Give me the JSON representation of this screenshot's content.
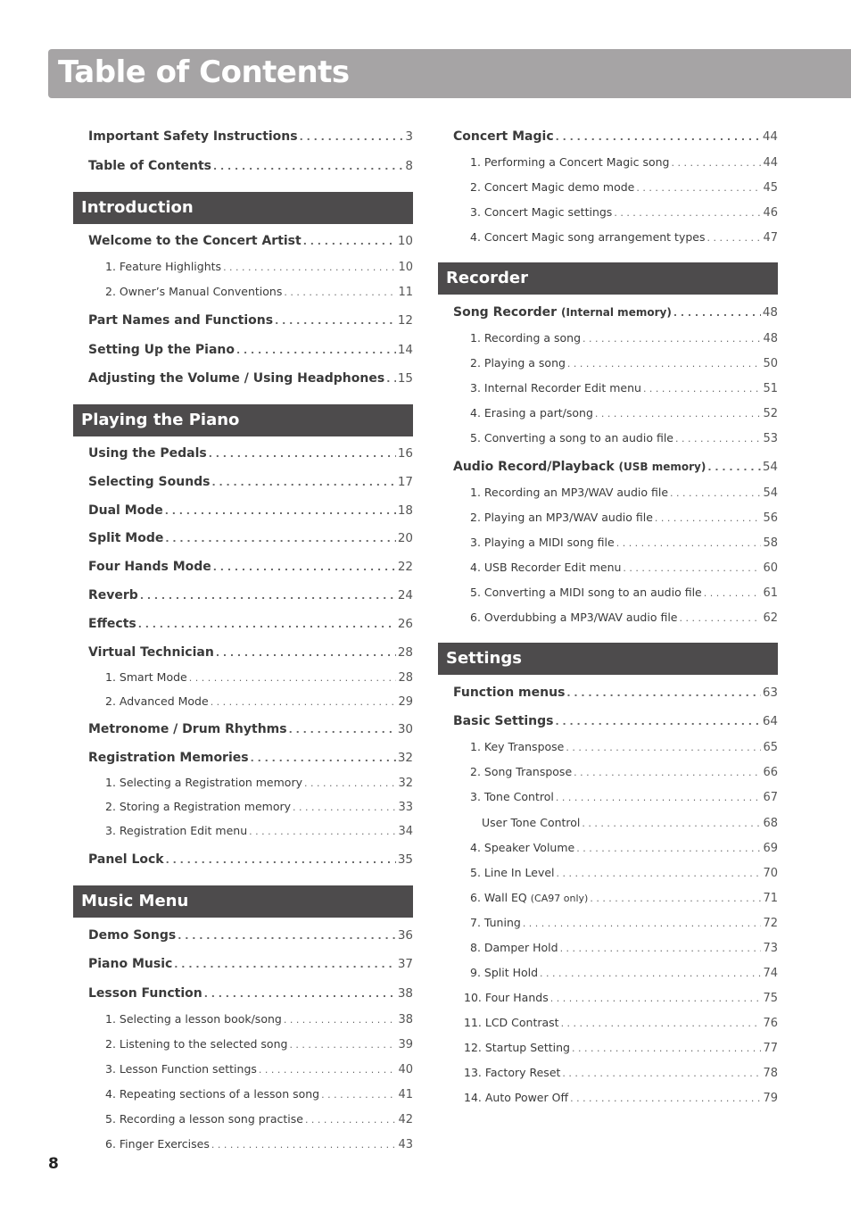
{
  "title": "Table of Contents",
  "page_number": "8",
  "left": {
    "top_entries": [
      {
        "label": "Important Safety Instructions",
        "page": "3"
      },
      {
        "label": "Table of Contents",
        "page": "8"
      }
    ],
    "introduction": {
      "heading": "Introduction",
      "entries": [
        {
          "label": "Welcome to the Concert Artist",
          "page": "10"
        },
        {
          "label": "1. Feature Highlights",
          "page": "10"
        },
        {
          "label": "2. Owner’s Manual Conventions",
          "page": "11"
        },
        {
          "label": "Part Names and Functions",
          "page": "12"
        },
        {
          "label": "Setting Up the Piano",
          "page": "14"
        },
        {
          "label": "Adjusting the Volume / Using Headphones",
          "page": "15"
        }
      ]
    },
    "playing": {
      "heading": "Playing the Piano",
      "entries": [
        {
          "label": "Using the Pedals",
          "page": "16"
        },
        {
          "label": "Selecting Sounds",
          "page": "17"
        },
        {
          "label": "Dual Mode",
          "page": "18"
        },
        {
          "label": "Split Mode",
          "page": "20"
        },
        {
          "label": "Four Hands Mode",
          "page": "22"
        },
        {
          "label": "Reverb",
          "page": "24"
        },
        {
          "label": "Effects",
          "page": "26"
        },
        {
          "label": "Virtual Technician",
          "page": "28"
        },
        {
          "label": "1. Smart Mode",
          "page": "28"
        },
        {
          "label": "2. Advanced Mode",
          "page": "29"
        },
        {
          "label": "Metronome / Drum Rhythms",
          "page": "30"
        },
        {
          "label": "Registration Memories",
          "page": "32"
        },
        {
          "label": "1. Selecting a Registration memory",
          "page": "32"
        },
        {
          "label": "2. Storing a Registration memory",
          "page": "33"
        },
        {
          "label": "3. Registration Edit menu",
          "page": "34"
        },
        {
          "label": "Panel Lock",
          "page": "35"
        }
      ]
    },
    "music": {
      "heading": "Music Menu",
      "entries": [
        {
          "label": "Demo Songs",
          "page": "36"
        },
        {
          "label": "Piano Music",
          "page": "37"
        },
        {
          "label": "Lesson Function",
          "page": "38"
        },
        {
          "label": "1. Selecting a lesson book/song",
          "page": "38"
        },
        {
          "label": "2. Listening to the selected song",
          "page": "39"
        },
        {
          "label": "3. Lesson Function settings",
          "page": "40"
        },
        {
          "label": "4. Repeating sections of a lesson song",
          "page": "41"
        },
        {
          "label": "5. Recording a lesson song practise",
          "page": "42"
        },
        {
          "label": "6. Finger Exercises",
          "page": "43"
        }
      ]
    }
  },
  "right": {
    "concert_magic": {
      "entries": [
        {
          "label": "Concert Magic",
          "page": "44"
        },
        {
          "label": "1. Performing a Concert Magic song",
          "page": "44"
        },
        {
          "label": "2. Concert Magic demo mode",
          "page": "45"
        },
        {
          "label": "3. Concert Magic settings",
          "page": "46"
        },
        {
          "label": "4. Concert Magic song arrangement types",
          "page": "47"
        }
      ]
    },
    "recorder": {
      "heading": "Recorder",
      "entries": [
        {
          "label": "Song Recorder",
          "note": "(Internal memory)",
          "page": "48"
        },
        {
          "label": "1. Recording a song",
          "page": "48"
        },
        {
          "label": "2. Playing a song",
          "page": "50"
        },
        {
          "label": "3. Internal Recorder Edit menu",
          "page": "51"
        },
        {
          "label": "4. Erasing a part/song",
          "page": "52"
        },
        {
          "label": "5. Converting a song to an audio file",
          "page": "53"
        },
        {
          "label": "Audio Record/Playback",
          "note": "(USB memory)",
          "page": "54"
        },
        {
          "label": "1. Recording an MP3/WAV audio file",
          "page": "54"
        },
        {
          "label": "2. Playing an MP3/WAV audio file",
          "page": "56"
        },
        {
          "label": "3. Playing a MIDI song file",
          "page": "58"
        },
        {
          "label": "4. USB Recorder Edit menu",
          "page": "60"
        },
        {
          "label": "5. Converting a MIDI song to an audio file",
          "page": "61"
        },
        {
          "label": "6. Overdubbing a MP3/WAV audio file",
          "page": "62"
        }
      ]
    },
    "settings": {
      "heading": "Settings",
      "entries": [
        {
          "label": "Function menus",
          "page": "63"
        },
        {
          "label": "Basic Settings",
          "page": "64"
        },
        {
          "label": "1. Key Transpose",
          "page": "65"
        },
        {
          "label": "2. Song Transpose",
          "page": "66"
        },
        {
          "label": "3. Tone Control",
          "page": "67"
        },
        {
          "label": "User Tone Control",
          "page": "68"
        },
        {
          "label": "4. Speaker Volume",
          "page": "69"
        },
        {
          "label": "5. Line In Level",
          "page": "70"
        },
        {
          "label": "6. Wall EQ",
          "note": "(CA97 only)",
          "page": "71"
        },
        {
          "label": "7. Tuning",
          "page": "72"
        },
        {
          "label": "8. Damper Hold",
          "page": "73"
        },
        {
          "label": "9. Split Hold",
          "page": "74"
        },
        {
          "label": "10. Four Hands",
          "page": "75"
        },
        {
          "label": "11. LCD Contrast",
          "page": "76"
        },
        {
          "label": "12. Startup Setting",
          "page": "77"
        },
        {
          "label": "13. Factory Reset",
          "page": "78"
        },
        {
          "label": "14. Auto Power Off",
          "page": "79"
        }
      ]
    }
  }
}
